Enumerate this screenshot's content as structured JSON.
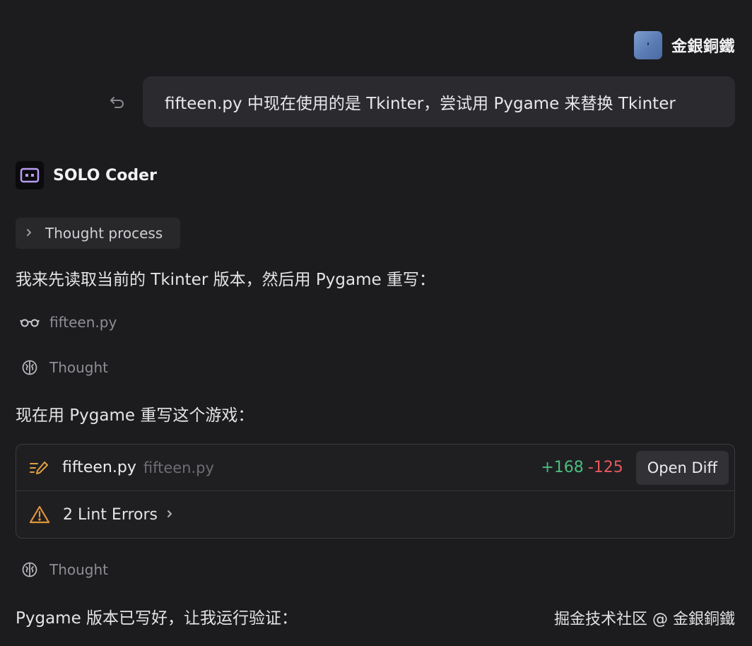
{
  "user": {
    "name": "金銀銅鐵",
    "message": "fifteen.py 中现在使用的是 Tkinter，尝试用 Pygame 来替换 Tkinter"
  },
  "agent": {
    "name": "SOLO Coder",
    "thought_process_label": "Thought process",
    "para1": "我来先读取当前的 Tkinter 版本，然后用 Pygame 重写：",
    "read_file": "fifteen.py",
    "thought1": "Thought",
    "para2": "现在用 Pygame 重写这个游戏：",
    "edit_card": {
      "file_name": "fifteen.py",
      "file_path": "fifteen.py",
      "additions": "+168",
      "deletions": "-125",
      "open_diff_label": "Open Diff",
      "lint_label": "2 Lint Errors"
    },
    "thought2": "Thought",
    "para3": "Pygame 版本已写好，让我运行验证："
  },
  "watermark": "掘金技术社区 @ 金銀銅鐵",
  "colors": {
    "background": "#1c1c1f",
    "additions": "#4bbd7e",
    "deletions": "#e8585b",
    "warning": "#e0963a",
    "edit_icon": "#e0a040",
    "agent_icon": "#b89cf5"
  },
  "icons": {
    "undo": "undo-icon",
    "agent": "robot-icon",
    "chevron": "chevron-right-icon",
    "read": "glasses-icon",
    "thought": "brain-icon",
    "edit": "edit-file-icon",
    "warning": "warning-triangle-icon"
  }
}
